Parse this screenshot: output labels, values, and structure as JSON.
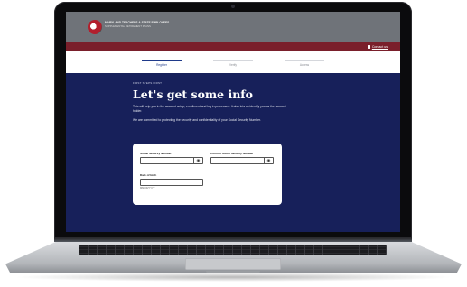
{
  "header": {
    "logo_line1": "MARYLAND TEACHERS & STATE EMPLOYEES",
    "logo_line2": "SUPPLEMENTAL RETIREMENT PLANS",
    "contact_label": "Contact us",
    "contact_icon": "phone-icon"
  },
  "stepper": {
    "steps": [
      {
        "label": "Register",
        "active": true
      },
      {
        "label": "Verify",
        "active": false
      },
      {
        "label": "Access",
        "active": false
      }
    ]
  },
  "main": {
    "eyebrow": "FIRST STEPS FIRST",
    "heading": "Let's get some info",
    "paragraph1": "This will help you in the account setup, enrollment and log in processes. It also lets us identify you as the account holder.",
    "paragraph2": "We are committed to protecting the security and confidentiality of your Social Security Number."
  },
  "form": {
    "ssn_label": "Social Security Number",
    "ssn_value": "",
    "confirm_ssn_label": "Confirm Social Security Number",
    "confirm_ssn_value": "",
    "dob_label": "Date of birth",
    "dob_value": "",
    "dob_hint": "MM/DD/YYYY",
    "reveal_icon": "eye-icon"
  },
  "colors": {
    "screen_bg": "#17205a",
    "header_gray": "#6f7379",
    "accent_red": "#7a1f2b",
    "step_active": "#1f3a8a"
  }
}
